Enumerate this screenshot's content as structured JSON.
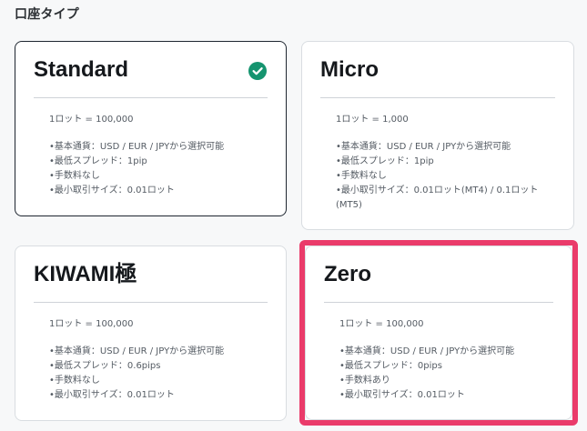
{
  "section_title": "口座タイプ",
  "cards": [
    {
      "title": "Standard",
      "selected": true,
      "lot": "1ロット = 100,000",
      "features": [
        "•基本通貨：USD / EUR / JPYから選択可能",
        "•最低スプレッド：1pip",
        "•手数料なし",
        "•最小取引サイズ：0.01ロット"
      ]
    },
    {
      "title": "Micro",
      "selected": false,
      "lot": "1ロット = 1,000",
      "features": [
        "•基本通貨：USD / EUR / JPYから選択可能",
        "•最低スプレッド：1pip",
        "•手数料なし",
        "•最小取引サイズ：0.01ロット(MT4) / 0.1ロット",
        "(MT5)"
      ]
    },
    {
      "title": "KIWAMI極",
      "selected": false,
      "lot": "1ロット = 100,000",
      "features": [
        "•基本通貨：USD / EUR / JPYから選択可能",
        "•最低スプレッド：0.6pips",
        "•手数料なし",
        "•最小取引サイズ：0.01ロット"
      ]
    },
    {
      "title": "Zero",
      "selected": false,
      "highlighted": true,
      "lot": "1ロット = 100,000",
      "features": [
        "•基本通貨：USD / EUR / JPYから選択可能",
        "•最低スプレッド：0pips",
        "•手数料あり",
        "•最小取引サイズ：0.01ロット"
      ]
    }
  ],
  "colors": {
    "check": "#15946f",
    "highlight": "#ea3b6a",
    "selected_border": "#1e2630"
  },
  "icons": {
    "selected": "check-circle-icon"
  }
}
